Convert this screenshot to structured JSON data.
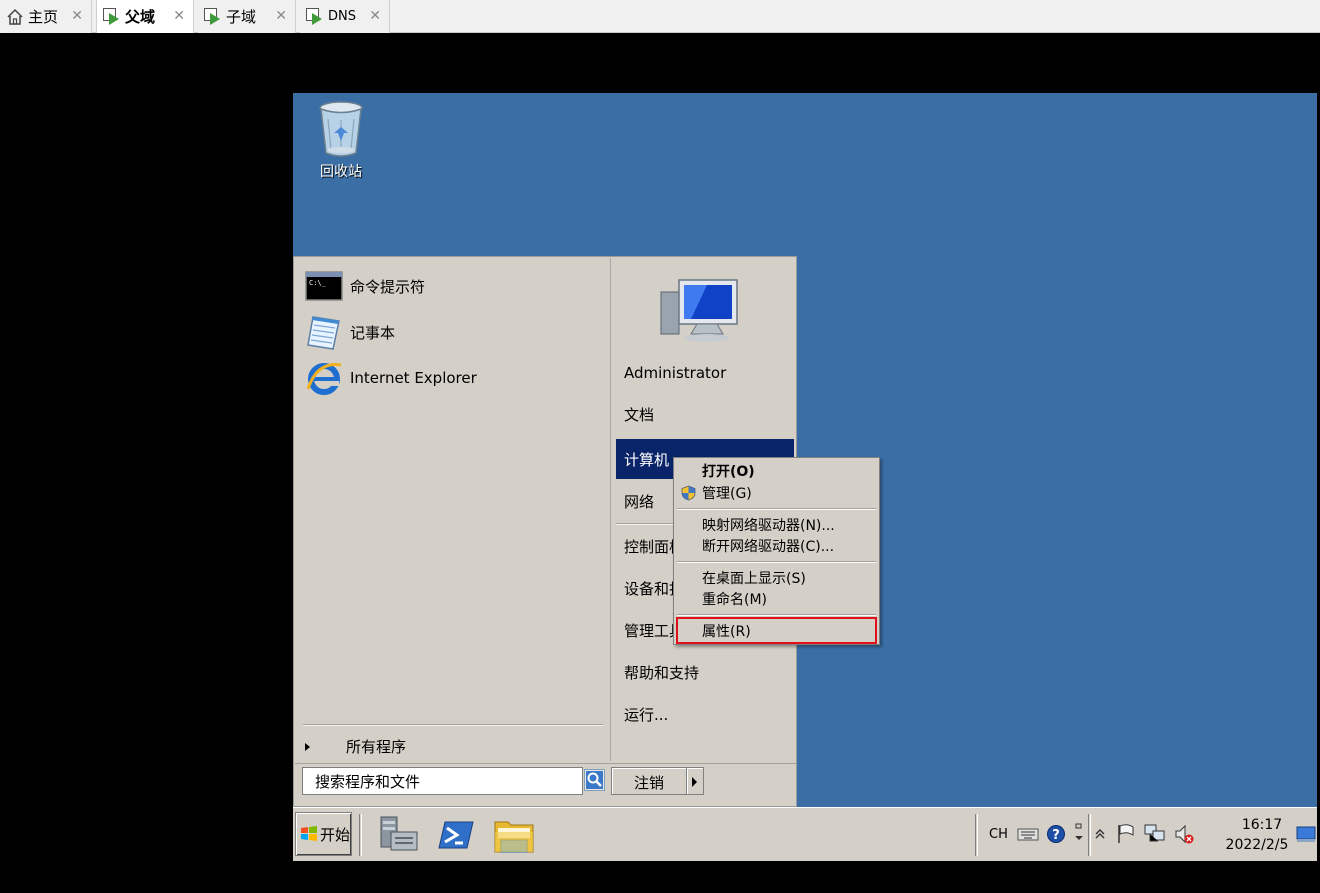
{
  "tabs": [
    {
      "label": "主页",
      "icon": "home-icon",
      "close": "✕"
    },
    {
      "label": "父域",
      "icon": "vm-icon",
      "close": "✕"
    },
    {
      "label": "子域",
      "icon": "vm-icon",
      "close": "✕"
    },
    {
      "label": "DNS",
      "icon": "vm-icon",
      "close": "✕"
    }
  ],
  "desktop": {
    "recycle_bin_label": "回收站"
  },
  "start_menu": {
    "programs": [
      {
        "label": "命令提示符",
        "icon": "cmd-icon"
      },
      {
        "label": "记事本",
        "icon": "notepad-icon"
      },
      {
        "label": "Internet Explorer",
        "icon": "ie-icon"
      }
    ],
    "all_programs": "所有程序",
    "right_items": {
      "user": "Administrator",
      "documents": "文档",
      "computer": "计算机",
      "network": "网络",
      "control_panel": "控制面板",
      "devices": "设备和打印机",
      "admin_tools": "管理工具",
      "help": "帮助和支持",
      "run": "运行..."
    },
    "search_placeholder": "搜索程序和文件",
    "logoff": "注销"
  },
  "context_menu": {
    "open": "打开(O)",
    "manage": "管理(G)",
    "map_drive": "映射网络驱动器(N)...",
    "disconnect_drive": "断开网络驱动器(C)...",
    "show_on_desktop": "在桌面上显示(S)",
    "rename": "重命名(M)",
    "properties": "属性(R)"
  },
  "taskbar": {
    "start_label": "开始",
    "lang": "CH",
    "clock_time": "16:17",
    "clock_date": "2022/2/5"
  },
  "colors": {
    "desktop": "#3a6ea5",
    "menu_face": "#d4d0c8",
    "highlight": "#0a246a",
    "selection_outline": "#e0101a"
  }
}
